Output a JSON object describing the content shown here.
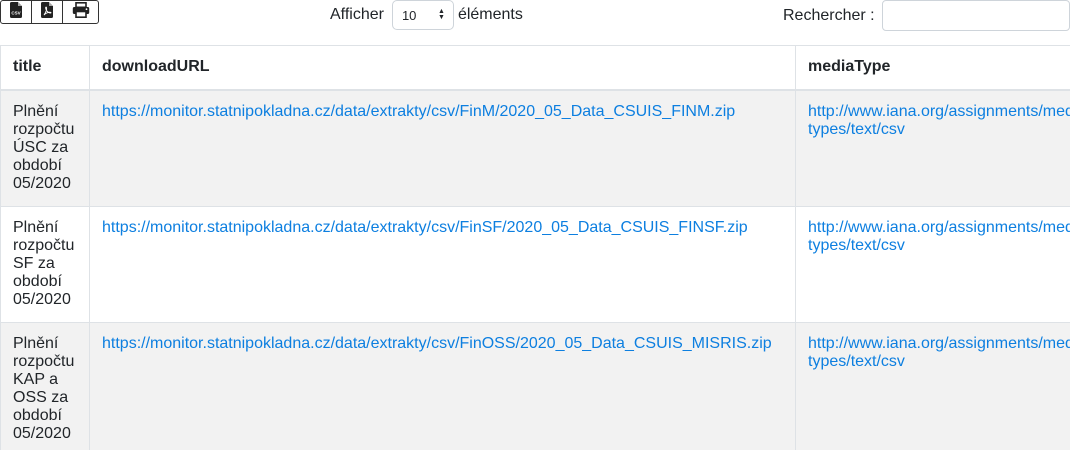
{
  "toolbar": {
    "export_buttons": [
      {
        "name": "csv-export-button",
        "icon": "csv-file-icon"
      },
      {
        "name": "pdf-export-button",
        "icon": "pdf-file-icon"
      },
      {
        "name": "print-button",
        "icon": "printer-icon"
      }
    ],
    "length": {
      "label_before": "Afficher",
      "selected_value": "10",
      "label_after": "éléments"
    },
    "search": {
      "label": "Rechercher :",
      "value": "",
      "placeholder": ""
    }
  },
  "table": {
    "columns": [
      "title",
      "downloadURL",
      "mediaType"
    ],
    "rows": [
      {
        "title": "Plnění rozpočtu ÚSC za období 05/2020",
        "downloadURL": "https://monitor.statnipokladna.cz/data/extrakty/csv/FinM/2020_05_Data_CSUIS_FINM.zip",
        "mediaType": "http://www.iana.org/assignments/media-types/text/csv"
      },
      {
        "title": "Plnění rozpočtu SF za období 05/2020",
        "downloadURL": "https://monitor.statnipokladna.cz/data/extrakty/csv/FinSF/2020_05_Data_CSUIS_FINSF.zip",
        "mediaType": "http://www.iana.org/assignments/media-types/text/csv"
      },
      {
        "title": "Plnění rozpočtu KAP a OSS za období 05/2020",
        "downloadURL": "https://monitor.statnipokladna.cz/data/extrakty/csv/FinOSS/2020_05_Data_CSUIS_MISRIS.zip",
        "mediaType": "http://www.iana.org/assignments/media-types/text/csv"
      }
    ]
  },
  "colors": {
    "link": "#0d7fe0",
    "stripe": "#f2f2f2",
    "border": "#dee2e6"
  }
}
